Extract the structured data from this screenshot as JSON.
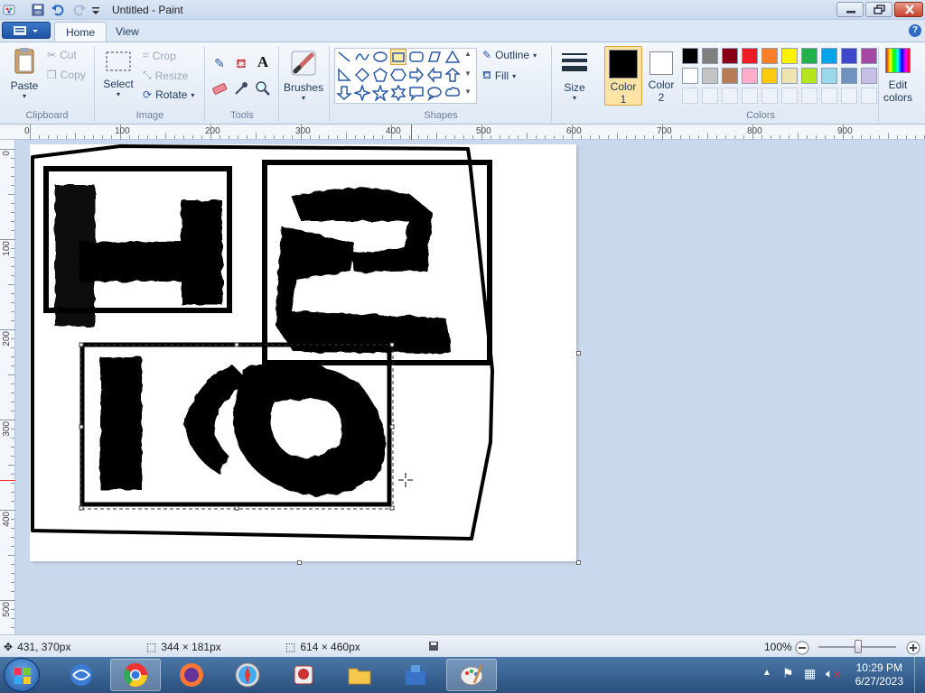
{
  "window": {
    "title": "Untitled - Paint"
  },
  "tabs": [
    {
      "label": "Home",
      "active": true
    },
    {
      "label": "View",
      "active": false
    }
  ],
  "ribbon": {
    "clipboard": {
      "group_label": "Clipboard",
      "paste": "Paste",
      "cut": "Cut",
      "copy": "Copy"
    },
    "image": {
      "group_label": "Image",
      "select": "Select",
      "crop": "Crop",
      "resize": "Resize",
      "rotate": "Rotate"
    },
    "tools": {
      "group_label": "Tools"
    },
    "brushes": {
      "label": "Brushes"
    },
    "shapes": {
      "group_label": "Shapes",
      "outline": "Outline",
      "fill": "Fill"
    },
    "size": {
      "label": "Size"
    },
    "color1": {
      "label_line1": "Color",
      "label_line2": "1",
      "value": "#000000"
    },
    "color2": {
      "label_line1": "Color",
      "label_line2": "2",
      "value": "#ffffff"
    },
    "colors": {
      "group_label": "Colors",
      "row1": [
        "#000000",
        "#7f7f7f",
        "#880015",
        "#ed1c24",
        "#ff7f27",
        "#fff200",
        "#22b14c",
        "#00a2e8",
        "#3f48cc",
        "#a349a4"
      ],
      "row2": [
        "#ffffff",
        "#c3c3c3",
        "#b97a57",
        "#ffaec9",
        "#ffc90e",
        "#efe4b0",
        "#b5e61d",
        "#99d9ea",
        "#7092be",
        "#c8bfe7"
      ]
    },
    "edit_colors": {
      "line1": "Edit",
      "line2": "colors"
    }
  },
  "ruler_h": [
    "0",
    "100",
    "200",
    "300",
    "400",
    "500",
    "600",
    "700",
    "800",
    "900"
  ],
  "ruler_v": [
    "0",
    "100",
    "200",
    "300",
    "400",
    "500"
  ],
  "statusbar": {
    "cursor_pos": "431, 370px",
    "selection_size": "344 × 181px",
    "canvas_size": "614 × 460px",
    "zoom": "100%"
  },
  "taskbar": {
    "time": "10:29 PM",
    "date": "6/27/2023"
  }
}
